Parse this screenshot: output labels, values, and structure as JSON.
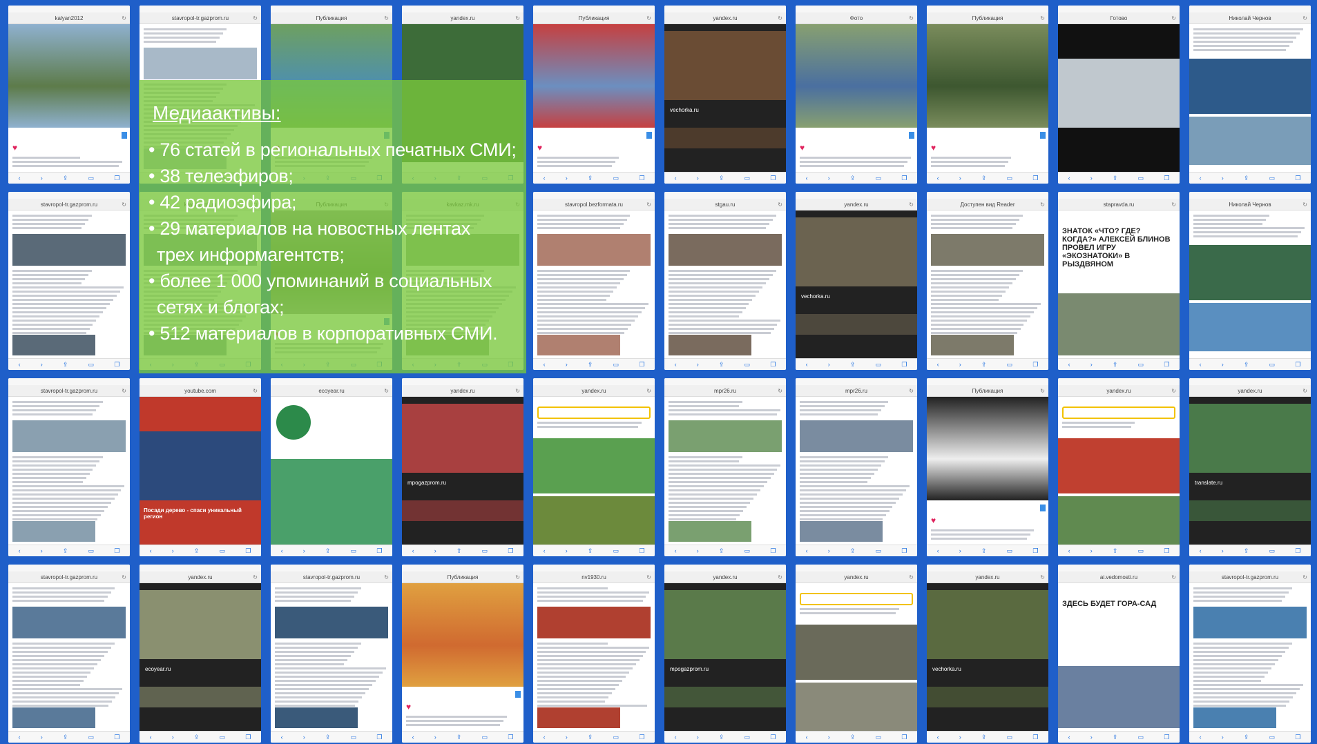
{
  "colors": {
    "background": "#1f5fc9",
    "overlay": "#7ac83c",
    "overlay_text": "#ffffff"
  },
  "overlay": {
    "heading": "Медиаактивы:",
    "lines": [
      "• 76 статей в региональных печатных СМИ;",
      "•  38 телеэфиров;",
      "•  42 радиоэфира;",
      "•  29 материалов на новостных лентах",
      "трех информагентств;",
      "•  более 1 000 упоминаний в социальных",
      "сетях и блогах;",
      "•  512 материалов в корпоративных СМИ."
    ]
  },
  "tiles": [
    {
      "url": "kalyan2012",
      "kind": "insta",
      "img": "#5d7b4a",
      "img2": "#8fb1cf"
    },
    {
      "url": "stavropol-tr.gazprom.ru",
      "kind": "article",
      "img": "#a8b9c8"
    },
    {
      "url": "Публикация",
      "kind": "insta",
      "img": "#4d8fb0",
      "img2": "#6ea060"
    },
    {
      "url": "yandex.ru",
      "kind": "photo",
      "img": "#3d6c39",
      "img2": "#7fb0d6"
    },
    {
      "url": "Публикация",
      "kind": "insta",
      "img": "#6c8fc0",
      "img2": "#c64040"
    },
    {
      "url": "yandex.ru",
      "kind": "dark",
      "img": "#6a4c34",
      "img2": "#222",
      "caption": "vechorka.ru"
    },
    {
      "url": "Фото",
      "kind": "insta",
      "img": "#4a6fa0",
      "img2": "#88a070"
    },
    {
      "url": "Публикация",
      "kind": "insta",
      "img": "#3d5730",
      "img2": "#7a8c5c"
    },
    {
      "url": "Готово",
      "kind": "video",
      "img": "#c0c8ce",
      "img2": "#111"
    },
    {
      "url": "Николай Чернов",
      "kind": "vk",
      "img": "#2d5a8a",
      "img2": "#7a9db8"
    },
    {
      "url": "stavropol-tr.gazprom.ru",
      "kind": "article",
      "img": "#5a6a78"
    },
    {
      "url": "kavkaz.mk.ru",
      "kind": "article",
      "img": "#8aa0a8"
    },
    {
      "url": "Публикация",
      "kind": "insta",
      "img": "#5a7050",
      "img2": "#999"
    },
    {
      "url": "kavkaz.mk.ru",
      "kind": "article",
      "img": "#8fa88a"
    },
    {
      "url": "stavropol.bezformata.ru",
      "kind": "article",
      "img": "#b08070"
    },
    {
      "url": "stgau.ru",
      "kind": "article",
      "img": "#7a6b5e"
    },
    {
      "url": "yandex.ru",
      "kind": "dark",
      "img": "#6b6350",
      "img2": "#222",
      "caption": "vechorka.ru"
    },
    {
      "url": "Доступен вид Reader",
      "kind": "article",
      "img": "#7d7a6a"
    },
    {
      "url": "stapravda.ru",
      "kind": "news",
      "img": "#7a8a70",
      "title": "ЗНАТОК «ЧТО? ГДЕ? КОГДА?» АЛЕКСЕЙ БЛИНОВ ПРОВЕЛ ИГРУ «ЭКОЗНАТОКИ» В РЫЗДВЯНОМ"
    },
    {
      "url": "Николай Чернов",
      "kind": "vk",
      "img": "#3a6a4a",
      "img2": "#5a8fc0"
    },
    {
      "url": "stavropol-tr.gazprom.ru",
      "kind": "article",
      "img": "#8aa0b0"
    },
    {
      "url": "youtube.com",
      "kind": "video",
      "img": "#2c4a7c",
      "img2": "#c0392b",
      "title": "Посади дерево - спаси уникальный регион"
    },
    {
      "url": "ecoyear.ru",
      "kind": "eco",
      "img": "#2c8a4a",
      "img2": "#4aa06a"
    },
    {
      "url": "yandex.ru",
      "kind": "dark",
      "img": "#a84040",
      "img2": "#222",
      "caption": "mpogazprom.ru"
    },
    {
      "url": "yandex.ru",
      "kind": "search",
      "img": "#5aa050",
      "img2": "#6c8a3c"
    },
    {
      "url": "mpr26.ru",
      "kind": "article",
      "img": "#7aa070"
    },
    {
      "url": "mpr26.ru",
      "kind": "article",
      "img": "#7a8ca0"
    },
    {
      "url": "Публикация",
      "kind": "insta",
      "img": "#eeeeee",
      "img2": "#222"
    },
    {
      "url": "yandex.ru",
      "kind": "search",
      "img": "#c04030",
      "img2": "#608a50"
    },
    {
      "url": "yandex.ru",
      "kind": "dark",
      "img": "#4a7a4a",
      "img2": "#222",
      "caption": "translate.ru"
    },
    {
      "url": "stavropol-tr.gazprom.ru",
      "kind": "article",
      "img": "#5a7a9a"
    },
    {
      "url": "yandex.ru",
      "kind": "dark",
      "img": "#8a9070",
      "img2": "#222",
      "caption": "ecoyear.ru"
    },
    {
      "url": "stavropol-tr.gazprom.ru",
      "kind": "article",
      "img": "#3a5a7a"
    },
    {
      "url": "Публикация",
      "kind": "insta",
      "img": "#d06a30",
      "img2": "#e0a040"
    },
    {
      "url": "nv1930.ru",
      "kind": "article",
      "img": "#b04030"
    },
    {
      "url": "yandex.ru",
      "kind": "dark",
      "img": "#5a7a4a",
      "img2": "#222",
      "caption": "mpogazprom.ru"
    },
    {
      "url": "yandex.ru",
      "kind": "search",
      "img": "#6a6a5a",
      "img2": "#8a8a7a"
    },
    {
      "url": "yandex.ru",
      "kind": "dark",
      "img": "#5a6a40",
      "img2": "#222",
      "caption": "vechorka.ru"
    },
    {
      "url": "ai.vedomosti.ru",
      "kind": "news",
      "img": "#6a80a0",
      "title": "ЗДЕСЬ БУДЕТ ГОРА-САД"
    },
    {
      "url": "stavropol-tr.gazprom.ru",
      "kind": "article",
      "img": "#4a80b0"
    }
  ]
}
